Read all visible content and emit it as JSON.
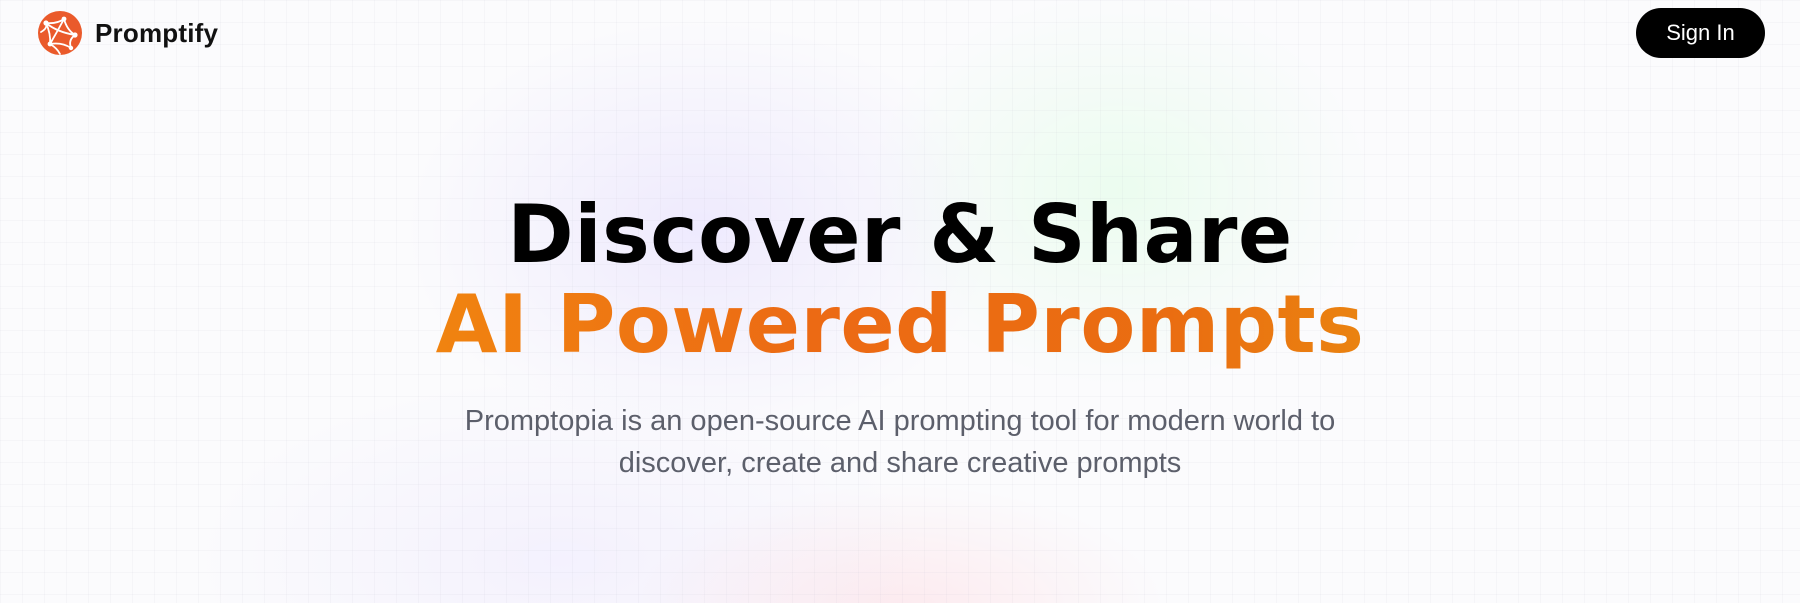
{
  "header": {
    "brand_name": "Promptify",
    "logo_icon": "globe-network-icon",
    "signin_label": "Sign In"
  },
  "hero": {
    "headline_primary": "Discover & Share",
    "headline_accent": "AI Powered Prompts",
    "description": "Promptopia is an open-source AI prompting tool for modern world to discover, create and share creative prompts"
  },
  "colors": {
    "accent_start": "#f6a10b",
    "accent_mid": "#ec6a14",
    "accent_end": "#eab30f",
    "logo": "#ea5a2b",
    "button_bg": "#000000",
    "body_text": "#5c5f6b"
  }
}
